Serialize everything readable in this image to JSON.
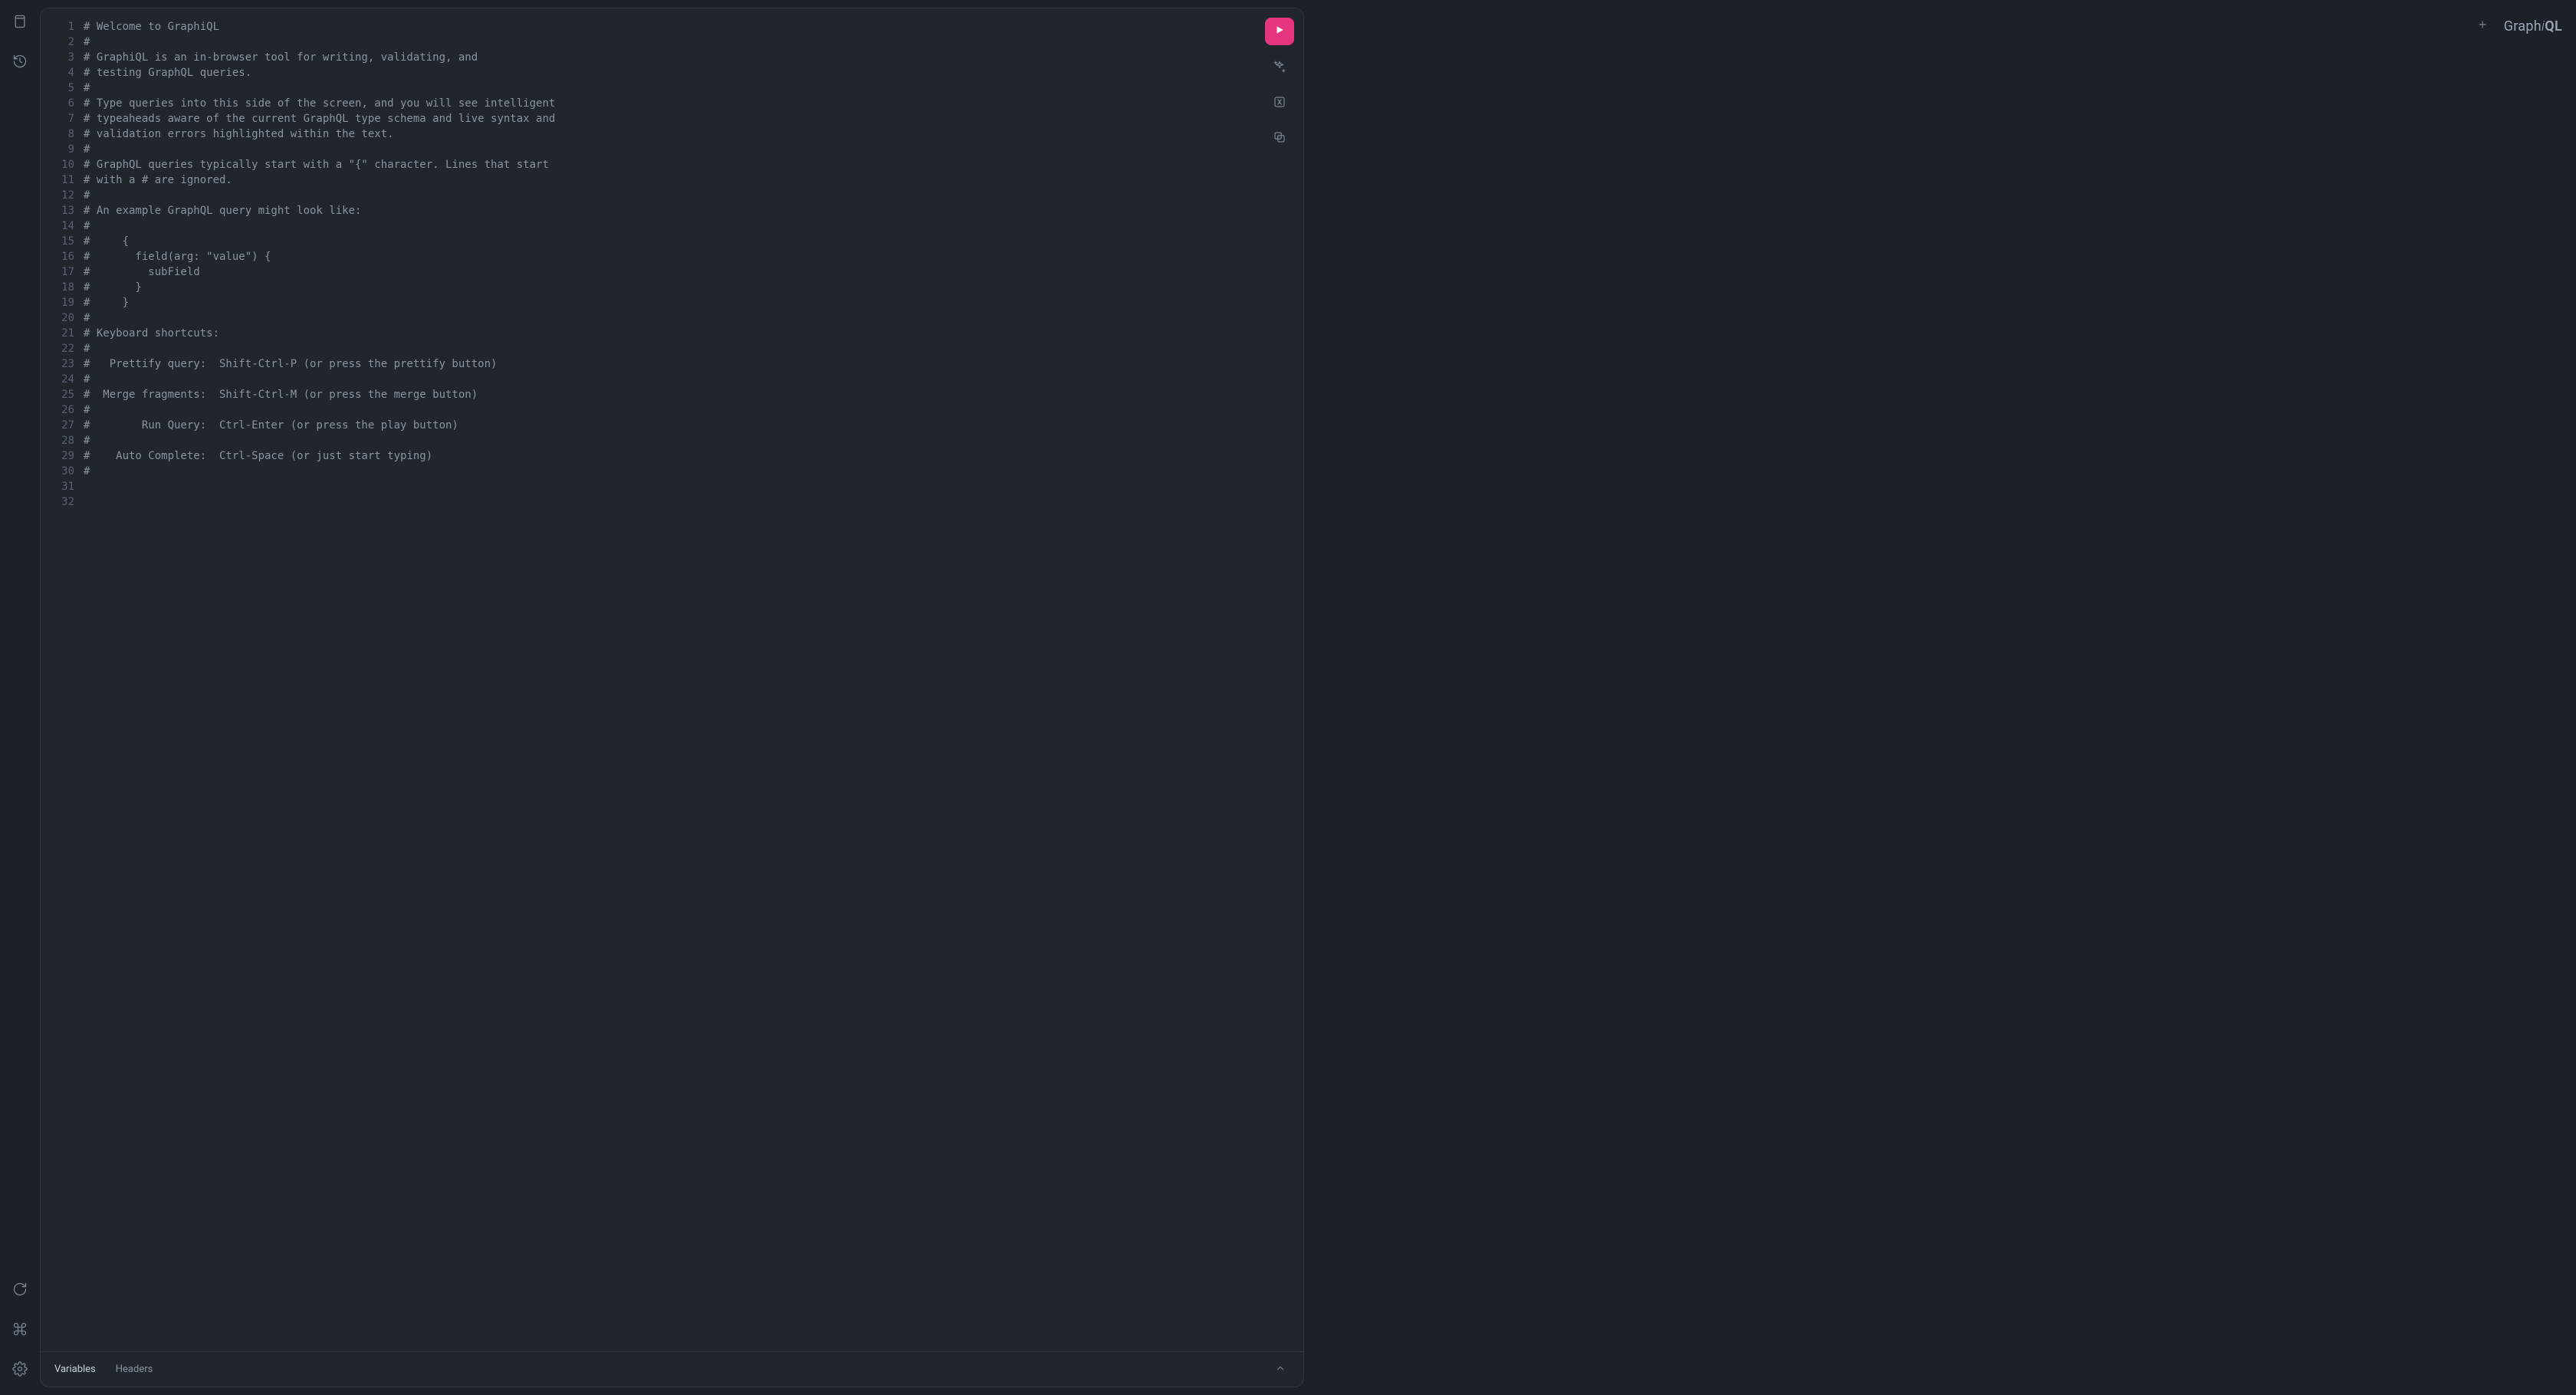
{
  "sidebar": {
    "docs_title": "Documentation Explorer",
    "history_title": "History",
    "refresh_title": "Re-fetch schema",
    "shortcuts_title": "Keyboard shortcuts",
    "settings_title": "Settings"
  },
  "editor": {
    "lines": [
      "# Welcome to GraphiQL",
      "#",
      "# GraphiQL is an in-browser tool for writing, validating, and",
      "# testing GraphQL queries.",
      "#",
      "# Type queries into this side of the screen, and you will see intelligent",
      "# typeaheads aware of the current GraphQL type schema and live syntax and",
      "# validation errors highlighted within the text.",
      "#",
      "# GraphQL queries typically start with a \"{\" character. Lines that start",
      "# with a # are ignored.",
      "#",
      "# An example GraphQL query might look like:",
      "#",
      "#     {",
      "#       field(arg: \"value\") {",
      "#         subField",
      "#       }",
      "#     }",
      "#",
      "# Keyboard shortcuts:",
      "#",
      "#   Prettify query:  Shift-Ctrl-P (or press the prettify button)",
      "#",
      "#  Merge fragments:  Shift-Ctrl-M (or press the merge button)",
      "#",
      "#        Run Query:  Ctrl-Enter (or press the play button)",
      "#",
      "#    Auto Complete:  Ctrl-Space (or just start typing)",
      "#",
      "",
      ""
    ]
  },
  "toolbar": {
    "run_title": "Execute query",
    "prettify_title": "Prettify query",
    "merge_title": "Merge fragments",
    "copy_title": "Copy query"
  },
  "footer": {
    "variables_label": "Variables",
    "headers_label": "Headers",
    "toggle_title": "Toggle editor tools"
  },
  "header": {
    "add_tab_title": "Add tab",
    "logo_graph": "Graph",
    "logo_i": "i",
    "logo_ql": "QL"
  },
  "colors": {
    "accent": "#e5357f",
    "bg": "#1c2128",
    "panel": "#21262d",
    "border": "#30363d",
    "comment": "#8b949e"
  }
}
